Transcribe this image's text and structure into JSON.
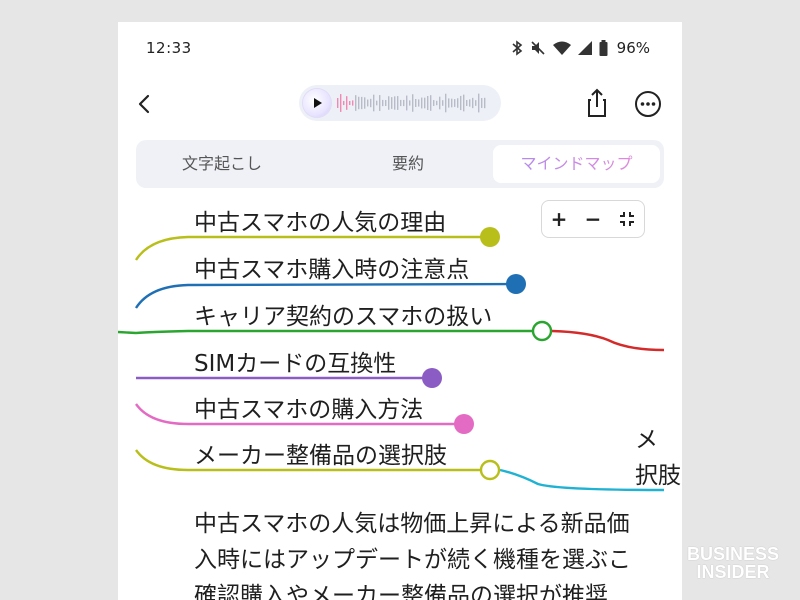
{
  "status_bar": {
    "time": "12:33",
    "battery": "96%",
    "icons": [
      "bluetooth-icon",
      "mute-icon",
      "wifi-icon",
      "signal-icon",
      "battery-icon"
    ]
  },
  "top_bar": {
    "back_icon": "back-arrow-icon",
    "play_icon": "play-icon",
    "share_icon": "share-icon",
    "more_icon": "more-icon"
  },
  "tabs": [
    {
      "label": "文字起こし",
      "selected": false
    },
    {
      "label": "要約",
      "selected": false
    },
    {
      "label": "マインドマップ",
      "selected": true
    }
  ],
  "zoom_controls": {
    "zoom_in": "+",
    "zoom_out": "−",
    "fit_icon": "fit-screen-icon"
  },
  "mindmap": {
    "nodes": [
      {
        "label": "中古スマホの人気の理由",
        "color": "#b9bf1a",
        "filled": true
      },
      {
        "label": "中古スマホ購入時の注意点",
        "color": "#1f6fb5",
        "filled": true
      },
      {
        "label": "キャリア契約のスマホの扱い",
        "color": "#2aa52f",
        "filled": false
      },
      {
        "label": "SIMカードの互換性",
        "color": "#8a5cc4",
        "filled": true
      },
      {
        "label": "中古スマホの購入方法",
        "color": "#e46bc3",
        "filled": true
      },
      {
        "label": "メーカー整備品の選択肢",
        "color": "#b9bf1a",
        "filled": false
      }
    ],
    "right_partial": [
      "メ",
      "択肢"
    ],
    "connector_colors": {
      "red": "#d42a2a",
      "cyan": "#1fb2d2"
    }
  },
  "summary_lines": [
    "中古スマホの人気は物価上昇による新品価",
    "入時にはアップデートが続く機種を選ぶこ",
    "確認購入やメーカー整備品の選択が推奨"
  ],
  "watermark": {
    "line1": "BUSINESS",
    "line2": "INSIDER"
  }
}
